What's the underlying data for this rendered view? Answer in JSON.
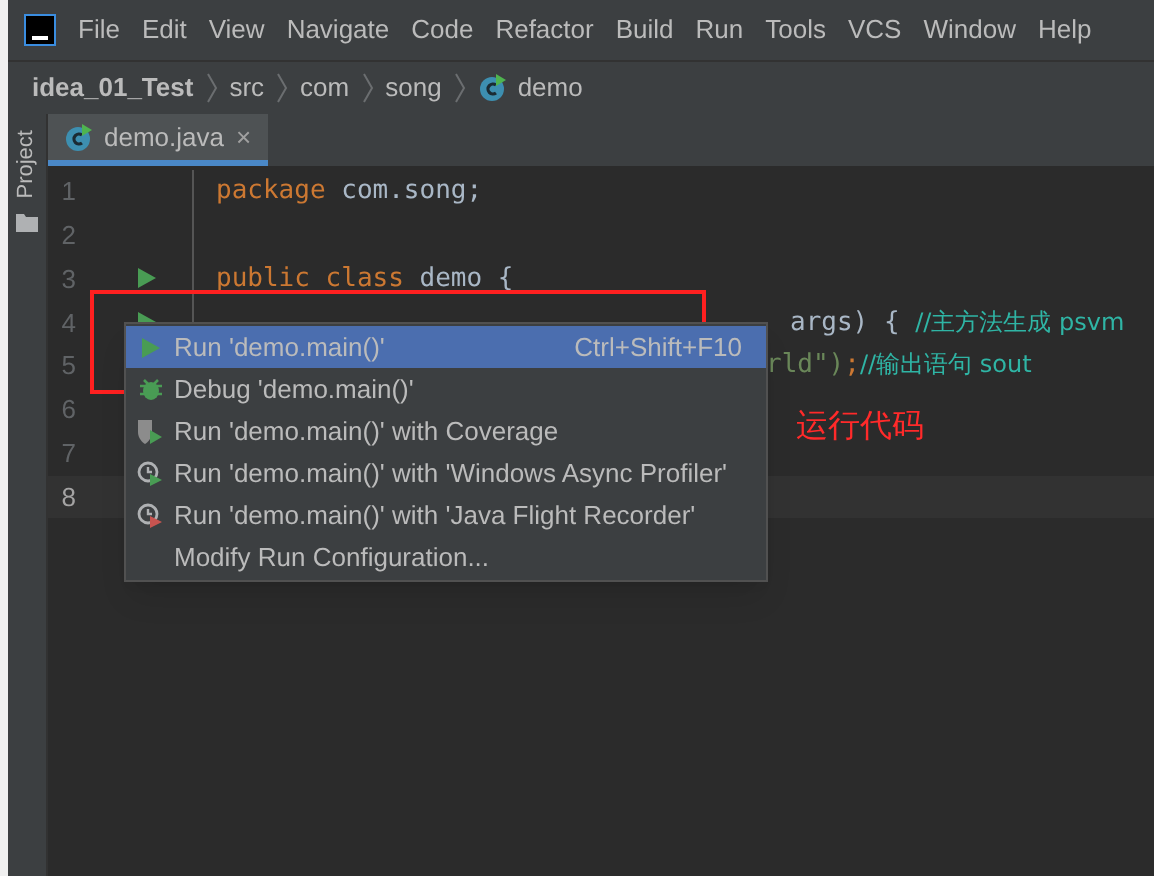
{
  "menu_bar": [
    "File",
    "Edit",
    "View",
    "Navigate",
    "Code",
    "Refactor",
    "Build",
    "Run",
    "Tools",
    "VCS",
    "Window",
    "Help"
  ],
  "breadcrumbs": [
    {
      "label": "idea_01_Test",
      "kind": "project"
    },
    {
      "label": "src",
      "kind": "folder"
    },
    {
      "label": "com",
      "kind": "folder"
    },
    {
      "label": "song",
      "kind": "folder"
    },
    {
      "label": "demo",
      "kind": "class"
    }
  ],
  "side_panel": {
    "label": "Project"
  },
  "tabs": [
    {
      "label": "demo.java",
      "close": "×",
      "selected": true
    }
  ],
  "editor": {
    "lines": [
      {
        "number": "1",
        "run_marker": false,
        "current": false,
        "segments": [
          {
            "text": "package ",
            "kind": "keyword"
          },
          {
            "text": "com.song;",
            "kind": "plain"
          }
        ]
      },
      {
        "number": "2",
        "run_marker": false,
        "current": false
      },
      {
        "number": "3",
        "run_marker": true,
        "current": false,
        "segments": [
          {
            "text": "public class ",
            "kind": "keyword"
          },
          {
            "text": "demo {",
            "kind": "plain"
          }
        ]
      },
      {
        "number": "4",
        "run_marker": true,
        "current": false,
        "segments": [
          {
            "text": "args) { ",
            "kind": "plain"
          },
          {
            "text": "//主方法生成 psvm",
            "kind": "comment"
          }
        ]
      },
      {
        "number": "5",
        "run_marker": false,
        "current": false,
        "segments": [
          {
            "text": "rld\")",
            "kind": "string"
          },
          {
            "text": ";",
            "kind": "keyword"
          },
          {
            "text": "//输出语句 sout",
            "kind": "comment"
          }
        ]
      },
      {
        "number": "6",
        "run_marker": false,
        "current": false
      },
      {
        "number": "7",
        "run_marker": false,
        "current": false
      },
      {
        "number": "8",
        "run_marker": false,
        "current": true
      }
    ]
  },
  "context_menu": [
    {
      "label": "Run 'demo.main()'",
      "shortcut": "Ctrl+Shift+F10",
      "kind": "run",
      "selected": true
    },
    {
      "label": "Debug 'demo.main()'",
      "kind": "debug",
      "selected": false
    },
    {
      "label": "Run 'demo.main()' with Coverage",
      "kind": "coverage",
      "selected": false
    },
    {
      "label": "Run 'demo.main()' with 'Windows Async Profiler'",
      "kind": "profiler",
      "selected": false
    },
    {
      "label": "Run 'demo.main()' with 'Java Flight Recorder'",
      "kind": "recorder",
      "selected": false
    },
    {
      "label": "Modify Run Configuration...",
      "kind": "plain",
      "selected": false
    }
  ],
  "annotation": {
    "text": "运行代码"
  }
}
